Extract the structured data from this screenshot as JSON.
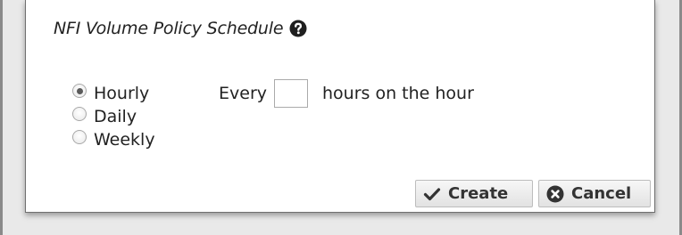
{
  "dialog": {
    "title": "NFI Volume Policy Schedule",
    "help_icon": "question-circle-icon"
  },
  "schedule": {
    "options": [
      {
        "label": "Hourly",
        "selected": true
      },
      {
        "label": "Daily",
        "selected": false
      },
      {
        "label": "Weekly",
        "selected": false
      }
    ],
    "every_label": "Every",
    "hours_value": "",
    "hours_suffix": "hours on the hour"
  },
  "buttons": {
    "create_label": "Create",
    "create_icon": "checkmark-icon",
    "cancel_label": "Cancel",
    "cancel_icon": "x-circle-icon"
  },
  "colors": {
    "background": "#e9e9e9",
    "dialog_bg": "#ffffff",
    "text": "#222222",
    "button_text": "#333333"
  }
}
